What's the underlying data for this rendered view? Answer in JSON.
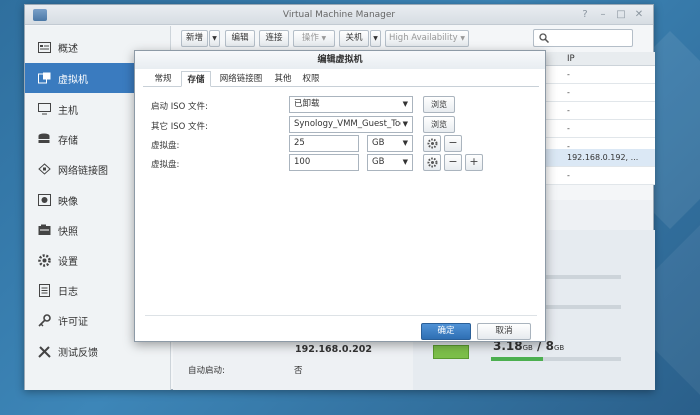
{
  "window": {
    "title": "Virtual Machine Manager"
  },
  "sidebar": {
    "items": [
      {
        "label": "概述",
        "icon": "overview-icon"
      },
      {
        "label": "虚拟机",
        "icon": "vm-icon",
        "active": true
      },
      {
        "label": "主机",
        "icon": "host-icon"
      },
      {
        "label": "存储",
        "icon": "storage-icon"
      },
      {
        "label": "网络链接图",
        "icon": "network-icon"
      },
      {
        "label": "映像",
        "icon": "image-icon"
      },
      {
        "label": "快照",
        "icon": "snapshot-icon"
      },
      {
        "label": "设置",
        "icon": "settings-icon"
      },
      {
        "label": "日志",
        "icon": "log-icon"
      },
      {
        "label": "许可证",
        "icon": "license-icon"
      },
      {
        "label": "测试反馈",
        "icon": "feedback-icon"
      }
    ]
  },
  "toolbar": {
    "new_label": "新增",
    "edit_label": "编辑",
    "connect_label": "连接",
    "action_label": "操作",
    "shutdown_label": "关机",
    "ha_label": "High Availability",
    "search_placeholder": ""
  },
  "list": {
    "ip_header": "IP",
    "rows": [
      "-",
      "-",
      "-",
      "-",
      "-",
      "192.168.0.192, ...",
      "-"
    ]
  },
  "detail": {
    "ip": "192.168.0.202",
    "autostart_label": "自动启动:",
    "autostart_value": "否",
    "ram_used": "3.18",
    "ram_unit1": "GB",
    "ram_sep": "/",
    "ram_total": "8",
    "ram_unit2": "GB"
  },
  "dialog": {
    "title": "编辑虚拟机",
    "tabs": [
      "常规",
      "存储",
      "网络链接图",
      "其他",
      "权限"
    ],
    "active_tab": "存储",
    "boot_iso_label": "启动 ISO 文件:",
    "boot_iso_value": "已卸载",
    "other_iso_label": "其它 ISO 文件:",
    "other_iso_value": "Synology_VMM_Guest_Tool",
    "browse_label": "浏览",
    "disk1_label": "虚拟盘:",
    "disk1_size": "25",
    "disk1_unit": "GB",
    "disk2_label": "虚拟盘:",
    "disk2_size": "100",
    "disk2_unit": "GB",
    "ok_label": "确定",
    "cancel_label": "取消"
  }
}
